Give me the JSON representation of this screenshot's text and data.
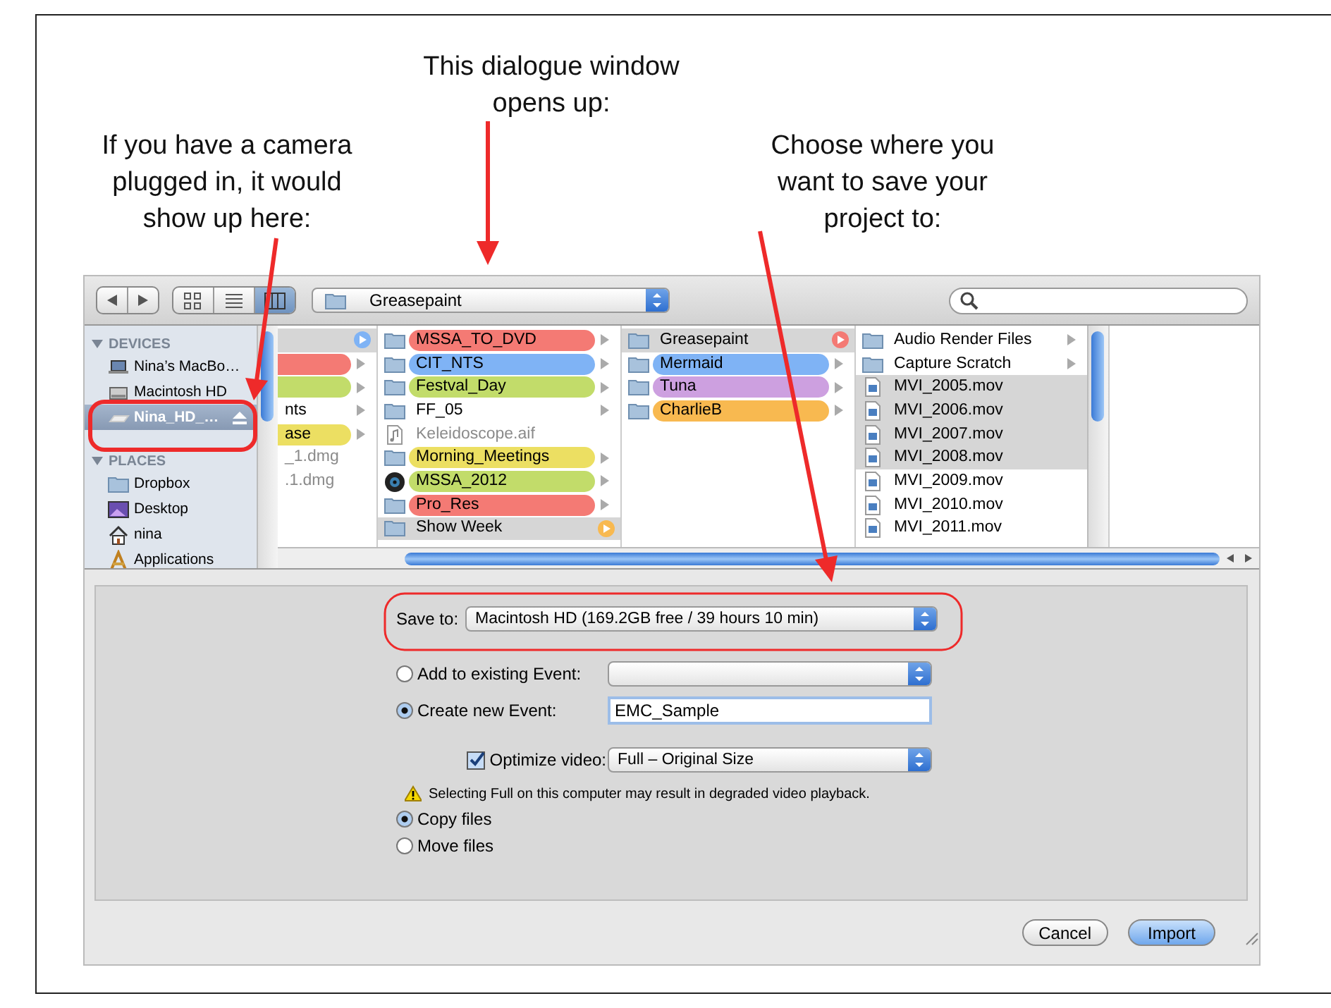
{
  "annotations": [
    {
      "kind": "left",
      "text": "If you have a camera plugged in, it would show up here:"
    },
    {
      "kind": "middle",
      "text": "This dialogue window opens up:"
    },
    {
      "kind": "right",
      "text": "Choose where you want to save your project to:"
    }
  ],
  "toolbar": {
    "view_buttons": [
      {
        "kind": "icon",
        "selected": false
      },
      {
        "kind": "list",
        "selected": false
      },
      {
        "kind": "column",
        "selected": true
      }
    ],
    "path_popup": {
      "value": "Greasepaint"
    }
  },
  "sidebar": {
    "sections": [
      {
        "title": "DEVICES",
        "expanded": true,
        "items": [
          {
            "label": "Nina’s MacBo…",
            "kind": "laptop",
            "selected": false,
            "eject": false
          },
          {
            "label": "Macintosh HD",
            "kind": "disk",
            "selected": false,
            "eject": false
          },
          {
            "label": "Nina_HD_…",
            "kind": "drive",
            "selected": true,
            "eject": true
          }
        ]
      },
      {
        "title": "PLACES",
        "expanded": true,
        "items": [
          {
            "label": "Dropbox",
            "kind": "folder",
            "selected": false,
            "eject": false
          },
          {
            "label": "Desktop",
            "kind": "desktop",
            "selected": false,
            "eject": false
          },
          {
            "label": "nina",
            "kind": "home",
            "selected": false,
            "eject": false
          },
          {
            "label": "Applications",
            "kind": "apps",
            "selected": false,
            "eject": false
          }
        ]
      }
    ]
  },
  "columns": [
    {
      "items": [
        {
          "selected": true,
          "color": "#7fb3f5",
          "arrow": true
        },
        {
          "selected": false,
          "color": "#f47a74",
          "arrow": true
        },
        {
          "selected": false,
          "color": "#c2dc6a",
          "arrow": true
        },
        {
          "name": "nts",
          "selected": false,
          "arrow": true
        },
        {
          "name": "ase",
          "selected": false,
          "color": "#ecdf62",
          "arrow": true
        },
        {
          "name": "_1.dmg",
          "selected": false,
          "disabled": true,
          "arrow": false
        },
        {
          "name": ".1.dmg",
          "selected": false,
          "disabled": true,
          "arrow": false
        }
      ]
    },
    {
      "items": [
        {
          "name": "MSSA_TO_DVD",
          "kind": "folder",
          "selected": false,
          "color": "#f47a74",
          "arrow": true
        },
        {
          "name": "CIT_NTS",
          "kind": "folder",
          "selected": false,
          "color": "#7fb3f5",
          "arrow": true
        },
        {
          "name": "Festval_Day",
          "kind": "folder",
          "selected": false,
          "color": "#c2dc6a",
          "arrow": true
        },
        {
          "name": "FF_05",
          "kind": "folder",
          "selected": false,
          "arrow": true
        },
        {
          "name": "Keleidoscope.aif",
          "kind": "audio",
          "selected": false,
          "disabled": true,
          "arrow": false
        },
        {
          "name": "Morning_Meetings",
          "kind": "folder",
          "selected": false,
          "color": "#ecdf62",
          "arrow": true
        },
        {
          "name": "MSSA_2012",
          "kind": "disc",
          "selected": false,
          "color": "#c2dc6a",
          "arrow": true
        },
        {
          "name": "Pro_Res",
          "kind": "folder",
          "selected": false,
          "color": "#f47a74",
          "arrow": true
        },
        {
          "name": "Show Week",
          "kind": "folder",
          "selected": true,
          "color": "#f8b950",
          "arrow": true
        }
      ]
    },
    {
      "items": [
        {
          "name": "Greasepaint",
          "kind": "folder",
          "selected": true,
          "color": "#f47a74",
          "arrow": true
        },
        {
          "name": "Mermaid",
          "kind": "folder",
          "selected": false,
          "color": "#7fb3f5",
          "arrow": true
        },
        {
          "name": "Tuna",
          "kind": "folder",
          "selected": false,
          "color": "#cda0e0",
          "arrow": true
        },
        {
          "name": "CharlieB",
          "kind": "folder",
          "selected": false,
          "color": "#f8b950",
          "arrow": true
        }
      ]
    },
    {
      "items": [
        {
          "name": "Audio Render Files",
          "kind": "folder",
          "selected": false,
          "arrow": true
        },
        {
          "name": "Capture Scratch",
          "kind": "folder",
          "selected": false,
          "arrow": true
        },
        {
          "name": "MVI_2005.mov",
          "kind": "movie",
          "selected": true,
          "arrow": false
        },
        {
          "name": "MVI_2006.mov",
          "kind": "movie",
          "selected": true,
          "arrow": false
        },
        {
          "name": "MVI_2007.mov",
          "kind": "movie",
          "selected": true,
          "arrow": false
        },
        {
          "name": "MVI_2008.mov",
          "kind": "movie",
          "selected": true,
          "arrow": false
        },
        {
          "name": "MVI_2009.mov",
          "kind": "movie",
          "selected": false,
          "arrow": false
        },
        {
          "name": "MVI_2010.mov",
          "kind": "movie",
          "selected": false,
          "arrow": false
        },
        {
          "name": "MVI_2011.mov",
          "kind": "movie",
          "selected": false,
          "arrow": false
        }
      ]
    }
  ],
  "save_to": {
    "label": "Save to:",
    "value": "Macintosh HD (169.2GB free / 39 hours 10 min)"
  },
  "event_options": [
    {
      "kind": "popup",
      "label": "Add to existing Event:",
      "selected": false
    },
    {
      "kind": "field",
      "label": "Create new Event:",
      "selected": true,
      "value": "EMC_Sample"
    }
  ],
  "optimize": {
    "label": "Optimize video:",
    "checked": true,
    "value": "Full – Original Size"
  },
  "warning": "Selecting Full on this computer may result in degraded video playback.",
  "file_options": [
    {
      "label": "Copy files",
      "selected": true
    },
    {
      "label": "Move files",
      "selected": false
    }
  ],
  "buttons": [
    {
      "label": "Cancel",
      "default": false
    },
    {
      "label": "Import",
      "default": true
    }
  ]
}
